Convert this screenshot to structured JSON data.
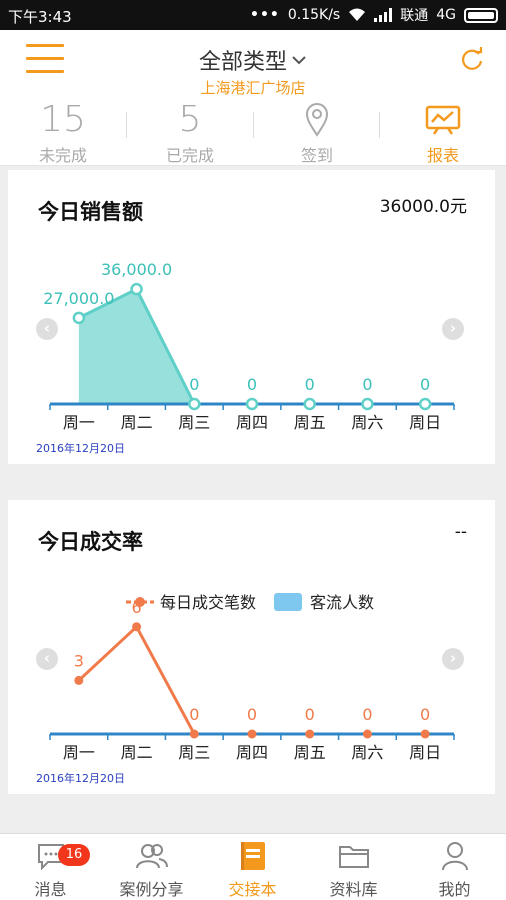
{
  "status_bar": {
    "time": "下午3:43",
    "dots": "•••",
    "speed": "0.15K/s",
    "carrier": "联通",
    "network": "4G"
  },
  "header": {
    "title": "全部类型",
    "subtitle": "上海港汇广场店",
    "menu_icon": "hamburger-icon",
    "refresh_icon": "refresh-icon",
    "accent": "#f39a1e"
  },
  "tabs": [
    {
      "value": "15",
      "label": "未完成"
    },
    {
      "value": "5",
      "label": "已完成"
    },
    {
      "icon": "location-pin-icon",
      "label": "签到"
    },
    {
      "icon": "chart-board-icon",
      "label": "报表",
      "active": true
    }
  ],
  "sales_card": {
    "title": "今日销售额",
    "value": "36000.0元",
    "date": "2016年12月20日"
  },
  "conversion_card": {
    "title": "今日成交率",
    "value": "--",
    "date": "2016年12月20日"
  },
  "chart_data": [
    {
      "type": "area",
      "categories": [
        "周一",
        "周二",
        "周三",
        "周四",
        "周五",
        "周六",
        "周日"
      ],
      "series": [
        {
          "values": [
            27000,
            36000,
            0,
            0,
            0,
            0,
            0
          ],
          "color": "#5fd0c8"
        }
      ],
      "point_labels": [
        "27,000.0",
        "36,000.0",
        "0",
        "0",
        "0",
        "0",
        "0"
      ],
      "ylim": [
        0,
        42000
      ],
      "grid": false
    },
    {
      "type": "line",
      "categories": [
        "周一",
        "周二",
        "周三",
        "周四",
        "周五",
        "周六",
        "周日"
      ],
      "series": [
        {
          "name": "每日成交笔数",
          "values": [
            3,
            6,
            0,
            0,
            0,
            0,
            0
          ],
          "color": "#f07a4a"
        },
        {
          "name": "客流人数",
          "values": [],
          "color": "#7ec8f0"
        }
      ],
      "point_labels": [
        "3",
        "6",
        "0",
        "0",
        "0",
        "0",
        "0"
      ],
      "ylim": [
        0,
        7.5
      ],
      "legend": "top-center",
      "grid": false
    }
  ],
  "bottom_nav": [
    {
      "label": "消息",
      "icon": "message-icon",
      "badge": "16"
    },
    {
      "label": "案例分享",
      "icon": "people-icon"
    },
    {
      "label": "交接本",
      "icon": "notebook-icon",
      "active": true
    },
    {
      "label": "资料库",
      "icon": "folder-icon"
    },
    {
      "label": "我的",
      "icon": "user-icon"
    }
  ]
}
